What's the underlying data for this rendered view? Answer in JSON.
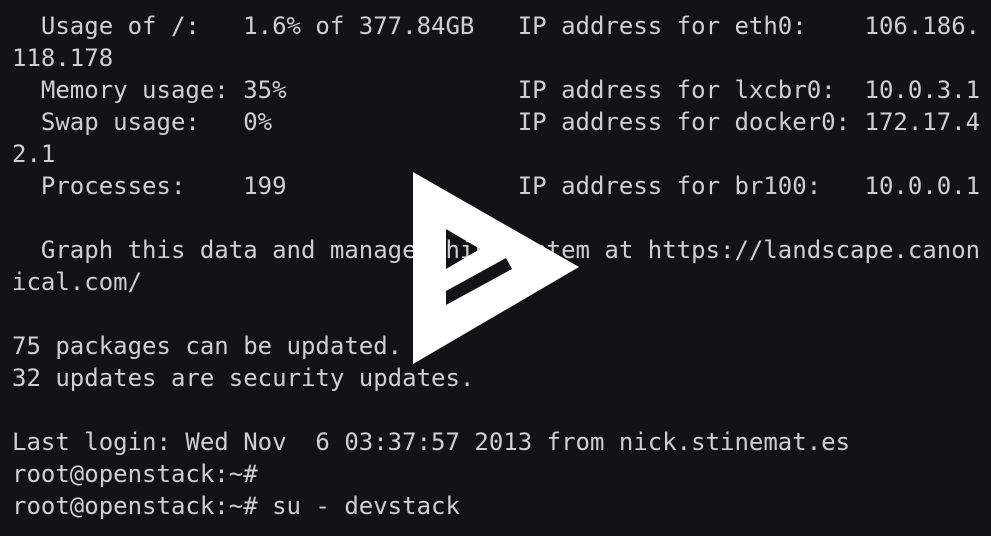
{
  "terminal": {
    "lines": [
      "  Usage of /:   1.6% of 377.84GB   IP address for eth0:    106.186.",
      "118.178",
      "  Memory usage: 35%                IP address for lxcbr0:  10.0.3.1",
      "  Swap usage:   0%                 IP address for docker0: 172.17.4",
      "2.1",
      "  Processes:    199                IP address for br100:   10.0.0.1",
      "",
      "  Graph this data and manage this system at https://landscape.canon",
      "ical.com/",
      "",
      "75 packages can be updated.",
      "32 updates are security updates.",
      "",
      "Last login: Wed Nov  6 03:37:57 2013 from nick.stinemat.es",
      "root@openstack:~#",
      "root@openstack:~# su - devstack"
    ]
  },
  "overlay": {
    "icon": "play-logo-icon",
    "color": "#ffffff"
  }
}
